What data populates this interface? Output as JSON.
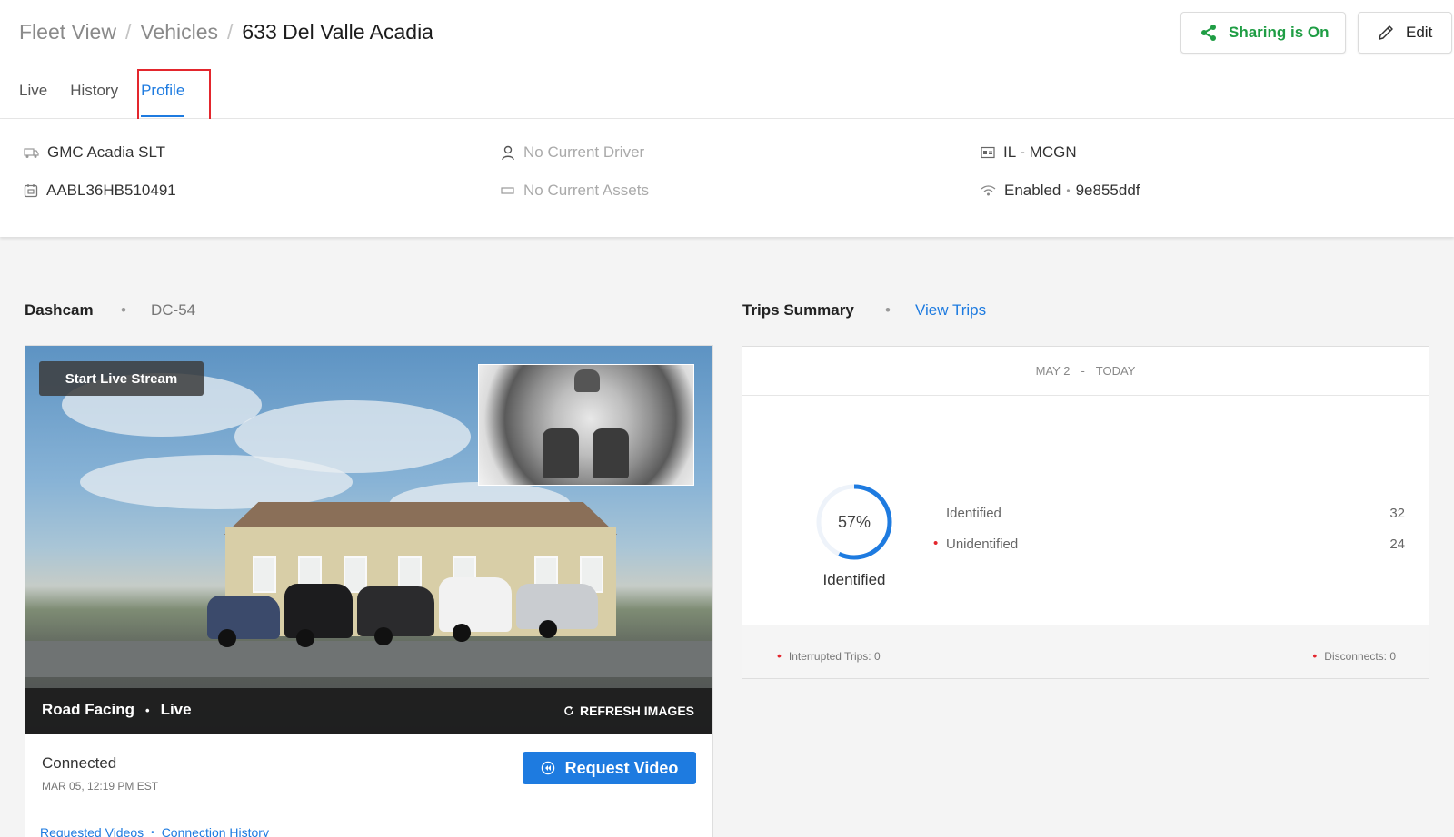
{
  "breadcrumb": {
    "root": "Fleet View",
    "parent": "Vehicles",
    "current": "633 Del Valle Acadia"
  },
  "header": {
    "share_label": "Sharing is On",
    "edit_label": "Edit"
  },
  "tabs": [
    {
      "label": "Live",
      "active": false
    },
    {
      "label": "History",
      "active": false
    },
    {
      "label": "Profile",
      "active": true
    }
  ],
  "vehicle_info": {
    "model": "GMC Acadia SLT",
    "vin": "AABL36HB510491",
    "driver": "No Current Driver",
    "assets": "No Current Assets",
    "plate": "IL - MCGN",
    "wifi_status": "Enabled",
    "wifi_id": "9e855ddf"
  },
  "dashcam": {
    "title": "Dashcam",
    "device_id": "DC-54",
    "start_stream_label": "Start Live Stream",
    "view_label": "Road Facing",
    "view_status": "Live",
    "refresh_label": "REFRESH IMAGES",
    "connection_status": "Connected",
    "connection_time": "MAR 05, 12:19 PM EST",
    "request_video_label": "Request Video",
    "requested_videos_link": "Requested Videos",
    "connection_history_link": "Connection History"
  },
  "trips": {
    "title": "Trips Summary",
    "view_link": "View Trips",
    "range_start": "MAY 2",
    "range_sep": "-",
    "range_end": "TODAY",
    "percent_label": "57%",
    "percent_value": 57,
    "caption": "Identified",
    "identified_label": "Identified",
    "identified_count": "32",
    "unidentified_label": "Unidentified",
    "unidentified_count": "24",
    "interrupted": "Interrupted Trips: 0",
    "disconnects": "Disconnects: 0"
  },
  "colors": {
    "accent": "#1e7be0",
    "share_green": "#1f9d44",
    "alert_red": "#e3262d"
  }
}
